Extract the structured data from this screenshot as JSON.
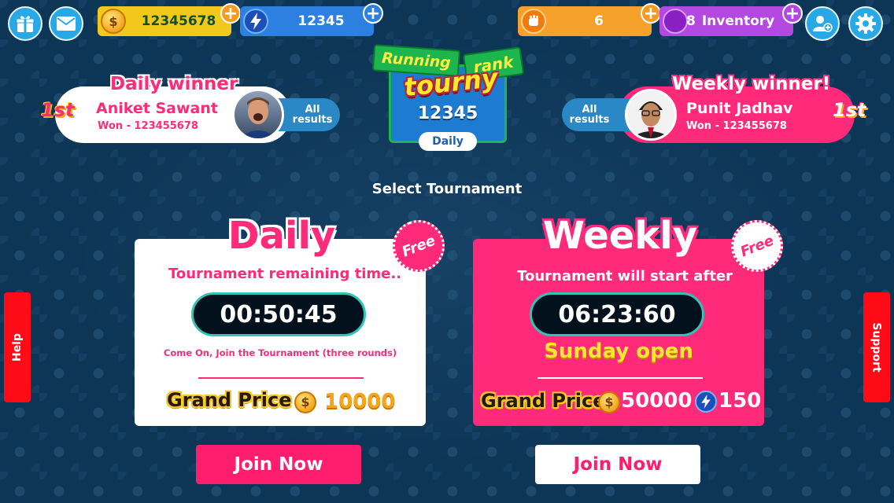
{
  "top_bar": {
    "coins": "12345678",
    "energy": "12345",
    "streak": "6",
    "inventory_count": "8",
    "inventory_label": "Inventory"
  },
  "daily_winner": {
    "title": "Daily winner",
    "rank": "1st",
    "name": "Aniket Sawant",
    "won": "Won - 123455678",
    "all_results": "All results"
  },
  "weekly_winner": {
    "title": "Weekly winner!",
    "rank": "1st",
    "name": "Punit Jadhav",
    "won": "Won - 123455678",
    "all_results": "All results"
  },
  "running_rank": {
    "line1": "Running",
    "line2": "rank",
    "line3": "tourny",
    "value": "12345",
    "period": "Daily"
  },
  "select_heading": "Select Tournament",
  "daily_card": {
    "title": "Daily",
    "badge": "Free",
    "subtitle": "Tournament remaining time..",
    "timer": "00:50:45",
    "note": "Come On, Join the Tournament (three rounds)",
    "grand_price_label": "Grand Price",
    "coin_prize": "10000",
    "join_label": "Join Now"
  },
  "weekly_card": {
    "title": "Weekly",
    "badge": "Free",
    "subtitle": "Tournament will start after",
    "timer": "06:23:60",
    "open_label": "Sunday open",
    "grand_price_label": "Grand Price",
    "coin_prize": "50000",
    "energy_prize": "150",
    "join_label": "Join Now"
  },
  "side_tabs": {
    "help": "Help",
    "support": "Support"
  },
  "colors": {
    "pink": "#ff2b7a",
    "coin_pill": "#f2c81c",
    "energy_pill": "#2d80e0",
    "streak_pill": "#f5a12b",
    "inventory_pill": "#b349e0",
    "side_tab_red": "#ff0a17"
  }
}
